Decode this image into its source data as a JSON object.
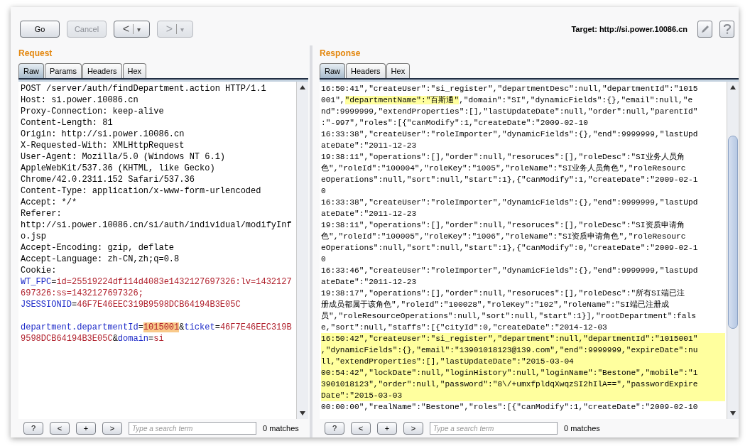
{
  "toolbar": {
    "buttons": [
      {
        "label": "Go",
        "disabled": false
      },
      {
        "label": "Cancel",
        "disabled": true
      }
    ],
    "nav": [
      {
        "label": "<",
        "menu": "▾",
        "disabled": false
      },
      {
        "label": ">",
        "menu": "▾",
        "disabled": true
      }
    ],
    "target": "Target: http://si.power.10086.cn"
  },
  "request": {
    "title": "Request",
    "tabs": [
      {
        "label": "Raw",
        "selected": true
      },
      {
        "label": "Params",
        "selected": false
      },
      {
        "label": "Headers",
        "selected": false
      },
      {
        "label": "Hex",
        "selected": false
      }
    ],
    "lines": [
      {
        "kind": "text",
        "text": "POST /server/auth/findDepartment.action HTTP/1.1"
      },
      {
        "kind": "text",
        "text": "Host: si.power.10086.cn"
      },
      {
        "kind": "text",
        "text": "Proxy-Connection: keep-alive"
      },
      {
        "kind": "text",
        "text": "Content-Length: 81"
      },
      {
        "kind": "text",
        "text": "Origin: http://si.power.10086.cn"
      },
      {
        "kind": "text",
        "text": "X-Requested-With: XMLHttpRequest"
      },
      {
        "kind": "text",
        "text": "User-Agent: Mozilla/5.0 (Windows NT 6.1)"
      },
      {
        "kind": "text",
        "text": "AppleWebKit/537.36 (KHTML, like Gecko)"
      },
      {
        "kind": "text",
        "text": "Chrome/42.0.2311.152 Safari/537.36"
      },
      {
        "kind": "text",
        "text": "Content-Type: application/x-www-form-urlencoded"
      },
      {
        "kind": "text",
        "text": "Accept: */*"
      },
      {
        "kind": "text",
        "text": "Referer:"
      },
      {
        "kind": "text",
        "text": "http://si.power.10086.cn/si/auth/individual/modifyInf"
      },
      {
        "kind": "text",
        "text": "o.jsp"
      },
      {
        "kind": "text",
        "text": "Accept-Encoding: gzip, deflate"
      },
      {
        "kind": "text",
        "text": "Accept-Language: zh-CN,zh;q=0.8"
      },
      {
        "kind": "text",
        "text": "Cookie:"
      },
      {
        "kind": "parts",
        "segments": [
          {
            "kind": "key",
            "text": "WT_FPC"
          },
          {
            "kind": "plain",
            "text": "="
          },
          {
            "kind": "value",
            "text": "id=25519224df114d4083e1432127697326:lv=1432127"
          }
        ]
      },
      {
        "kind": "parts",
        "segments": [
          {
            "kind": "value",
            "text": "697326:ss=1432127697326;"
          }
        ]
      },
      {
        "kind": "parts",
        "segments": [
          {
            "kind": "key",
            "text": "JSESSIONID"
          },
          {
            "kind": "plain",
            "text": "="
          },
          {
            "kind": "value",
            "text": "46F7E46EEC319B9598DCB64194B3E05C"
          }
        ]
      },
      {
        "kind": "blank"
      },
      {
        "kind": "parts",
        "segments": [
          {
            "kind": "key",
            "text": "department.departmentId"
          },
          {
            "kind": "plain",
            "text": "="
          },
          {
            "kind": "selection",
            "text": "1015001"
          },
          {
            "kind": "plain",
            "text": "&"
          },
          {
            "kind": "key",
            "text": "ticket"
          },
          {
            "kind": "plain",
            "text": "="
          },
          {
            "kind": "value",
            "text": "46F7E46EEC319B"
          }
        ]
      },
      {
        "kind": "parts",
        "segments": [
          {
            "kind": "value",
            "text": "9598DCB64194B3E05C"
          },
          {
            "kind": "plain",
            "text": "&"
          },
          {
            "kind": "key",
            "text": "domain"
          },
          {
            "kind": "plain",
            "text": "="
          },
          {
            "kind": "value",
            "text": "si"
          }
        ]
      }
    ],
    "search_buttons": [
      "?",
      "<",
      "+",
      ">"
    ],
    "search": {
      "placeholder": "Type a search term",
      "matches": "0 matches"
    }
  },
  "response": {
    "title": "Response",
    "tabs": [
      {
        "label": "Raw",
        "selected": true
      },
      {
        "label": "Headers",
        "selected": false
      },
      {
        "label": "Hex",
        "selected": false
      }
    ],
    "lines": [
      {
        "highlighted": false,
        "kind": "text",
        "text": "16:50:41\",\"createUser\":\"si_register\",\"departmentDesc\":null,\"departmentId\":\"1015"
      },
      {
        "highlighted": false,
        "kind": "parts",
        "segments": [
          {
            "kind": "plain",
            "text": "001\","
          },
          {
            "kind": "mark",
            "text": "\"departmentName\":\"百斯通\""
          },
          {
            "kind": "plain",
            "text": ",\"domain\":\"SI\",\"dynamicFields\":{},\"email\":null,\"e"
          }
        ]
      },
      {
        "highlighted": false,
        "kind": "text",
        "text": "nd\":9999999,\"extendProperties\":[],\"lastUpdateDate\":null,\"order\":null,\"parentId\""
      },
      {
        "highlighted": false,
        "kind": "text",
        "text": ":\"-997\",\"roles\":[{\"canModify\":1,\"createDate\":\"2009-02-10"
      },
      {
        "highlighted": false,
        "kind": "text",
        "text": "16:33:38\",\"createUser\":\"roleImporter\",\"dynamicFields\":{},\"end\":9999999,\"lastUpd"
      },
      {
        "highlighted": false,
        "kind": "text",
        "text": "ateDate\":\"2011-12-23"
      },
      {
        "highlighted": false,
        "kind": "text",
        "text": "19:38:11\",\"operations\":[],\"order\":null,\"resoruces\":[],\"roleDesc\":\"SI业务人员角"
      },
      {
        "highlighted": false,
        "kind": "text",
        "text": "色\",\"roleId\":\"100004\",\"roleKey\":\"1005\",\"roleName\":\"SI业务人员角色\",\"roleResourc"
      },
      {
        "highlighted": false,
        "kind": "text",
        "text": "eOperations\":null,\"sort\":null,\"start\":1},{\"canModify\":1,\"createDate\":\"2009-02-1"
      },
      {
        "highlighted": false,
        "kind": "text",
        "text": "0"
      },
      {
        "highlighted": false,
        "kind": "text",
        "text": "16:33:38\",\"createUser\":\"roleImporter\",\"dynamicFields\":{},\"end\":9999999,\"lastUpd"
      },
      {
        "highlighted": false,
        "kind": "text",
        "text": "ateDate\":\"2011-12-23"
      },
      {
        "highlighted": false,
        "kind": "text",
        "text": "19:38:11\",\"operations\":[],\"order\":null,\"resoruces\":[],\"roleDesc\":\"SI资质申请角"
      },
      {
        "highlighted": false,
        "kind": "text",
        "text": "色\",\"roleId\":\"100005\",\"roleKey\":\"1006\",\"roleName\":\"SI资质申请角色\",\"roleResourc"
      },
      {
        "highlighted": false,
        "kind": "text",
        "text": "eOperations\":null,\"sort\":null,\"start\":1},{\"canModify\":0,\"createDate\":\"2009-02-1"
      },
      {
        "highlighted": false,
        "kind": "text",
        "text": "0"
      },
      {
        "highlighted": false,
        "kind": "text",
        "text": "16:33:46\",\"createUser\":\"roleImporter\",\"dynamicFields\":{},\"end\":9999999,\"lastUpd"
      },
      {
        "highlighted": false,
        "kind": "text",
        "text": "ateDate\":\"2011-12-23"
      },
      {
        "highlighted": false,
        "kind": "text",
        "text": "19:38:17\",\"operations\":[],\"order\":null,\"resoruces\":[],\"roleDesc\":\"所有SI端已注"
      },
      {
        "highlighted": false,
        "kind": "text",
        "text": "册成员都属于该角色\",\"roleId\":\"100028\",\"roleKey\":\"102\",\"roleName\":\"SI端已注册成"
      },
      {
        "highlighted": false,
        "kind": "text",
        "text": "员\",\"roleResourceOperations\":null,\"sort\":null,\"start\":1}],\"rootDepartment\":fals"
      },
      {
        "highlighted": false,
        "kind": "text",
        "text": "e,\"sort\":null,\"staffs\":[{\"cityId\":0,\"createDate\":\"2014-12-03"
      },
      {
        "highlighted": true,
        "kind": "text",
        "text": "16:50:42\",\"createUser\":\"si_register\",\"department\":null,\"departmentId\":\"1015001\""
      },
      {
        "highlighted": true,
        "kind": "text",
        "text": ",\"dynamicFields\":{},\"email\":\"13901018123@139.com\",\"end\":9999999,\"expireDate\":nu"
      },
      {
        "highlighted": true,
        "kind": "text",
        "text": "ll,\"extendProperties\":[],\"lastUpdateDate\":\"2015-03-04"
      },
      {
        "highlighted": true,
        "kind": "text",
        "text": "00:54:42\",\"lockDate\":null,\"loginHistory\":null,\"loginName\":\"Bestone\",\"mobile\":\"1"
      },
      {
        "highlighted": true,
        "kind": "text",
        "text": "3901018123\",\"order\":null,\"password\":\"8\\/+umxfpldqXwqzSI2hIlA==\",\"passwordExpire"
      },
      {
        "highlighted": true,
        "kind": "text",
        "text": "Date\":\"2015-03-03"
      },
      {
        "highlighted": false,
        "kind": "text",
        "text": "00:00:00\",\"realName\":\"Bestone\",\"roles\":[{\"canModify\":1,\"createDate\":\"2009-02-10"
      }
    ],
    "search_buttons": [
      "?",
      "<",
      "+",
      ">"
    ],
    "search": {
      "placeholder": "Type a search term",
      "matches": "0 matches"
    }
  }
}
